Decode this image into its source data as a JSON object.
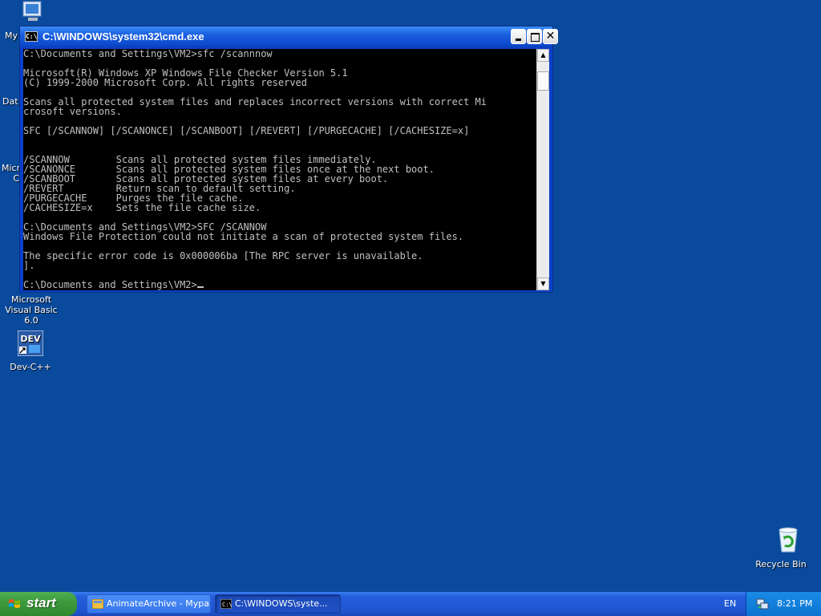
{
  "desktop": {
    "icons": {
      "my_computer": "My",
      "data": "Dat",
      "microsoft_partial": "Micro",
      "microsoft_partial_2": "C",
      "vb6": "Microsoft Visual Basic 6.0",
      "devcpp": "Dev-C++",
      "recycle_bin": "Recycle Bin"
    }
  },
  "window": {
    "title": "C:\\WINDOWS\\system32\\cmd.exe",
    "icon_label": "C:\\",
    "console_lines": [
      "C:\\Documents and Settings\\VM2>sfc /scannnow",
      "",
      "Microsoft(R) Windows XP Windows File Checker Version 5.1",
      "(C) 1999-2000 Microsoft Corp. All rights reserved",
      "",
      "Scans all protected system files and replaces incorrect versions with correct Mi",
      "crosoft versions.",
      "",
      "SFC [/SCANNOW] [/SCANONCE] [/SCANBOOT] [/REVERT] [/PURGECACHE] [/CACHESIZE=x]",
      "",
      "",
      "/SCANNOW        Scans all protected system files immediately.",
      "/SCANONCE       Scans all protected system files once at the next boot.",
      "/SCANBOOT       Scans all protected system files at every boot.",
      "/REVERT         Return scan to default setting.",
      "/PURGECACHE     Purges the file cache.",
      "/CACHESIZE=x    Sets the file cache size.",
      "",
      "C:\\Documents and Settings\\VM2>SFC /SCANNOW",
      "Windows File Protection could not initiate a scan of protected system files.",
      "",
      "The specific error code is 0x000006ba [The RPC server is unavailable.",
      "].",
      "",
      "C:\\Documents and Settings\\VM2>"
    ]
  },
  "taskbar": {
    "start_label": "start",
    "tasks": [
      {
        "label": "AnimateArchive - Mypal",
        "active": false
      },
      {
        "label": "C:\\WINDOWS\\syste...",
        "active": true
      }
    ],
    "language": "EN",
    "clock": "8:21 PM"
  },
  "colors": {
    "desktop": "#0a4a9c",
    "console_bg": "#000000",
    "console_text": "#c0c0c0",
    "titlebar": "#1a5fe0",
    "start_green": "#3c9a3d"
  }
}
